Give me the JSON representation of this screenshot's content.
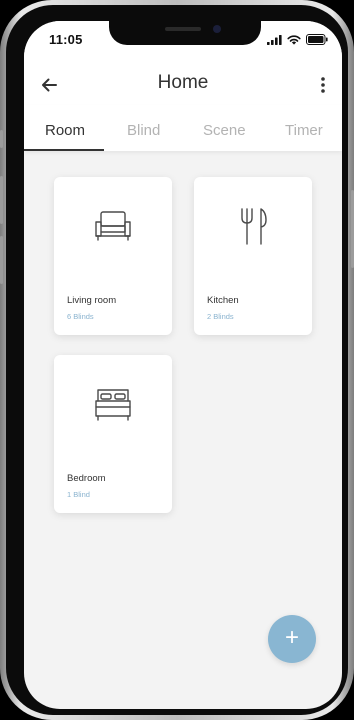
{
  "status_bar": {
    "time": "11:05",
    "icons": [
      "signal-icon",
      "wifi-icon",
      "battery-icon"
    ]
  },
  "header": {
    "title": "Home",
    "back_icon": "back-arrow-icon",
    "menu_icon": "more-vertical-icon"
  },
  "tabs": [
    {
      "label": "Room",
      "active": true
    },
    {
      "label": "Blind",
      "active": false
    },
    {
      "label": "Scene",
      "active": false
    },
    {
      "label": "Timer",
      "active": false
    }
  ],
  "rooms": [
    {
      "name": "Living room",
      "count": "6 Blinds",
      "icon": "armchair-icon"
    },
    {
      "name": "Kitchen",
      "count": "2 Blinds",
      "icon": "fork-knife-icon"
    },
    {
      "name": "Bedroom",
      "count": "1 Blind",
      "icon": "bed-icon"
    }
  ],
  "fab": {
    "label": "+",
    "icon": "plus-icon"
  },
  "colors": {
    "accent": "#89b6d2",
    "sub_text": "#8ab3cf",
    "text": "#333333",
    "inactive_tab": "#b3b3b3",
    "background": "#f3f3f3"
  }
}
